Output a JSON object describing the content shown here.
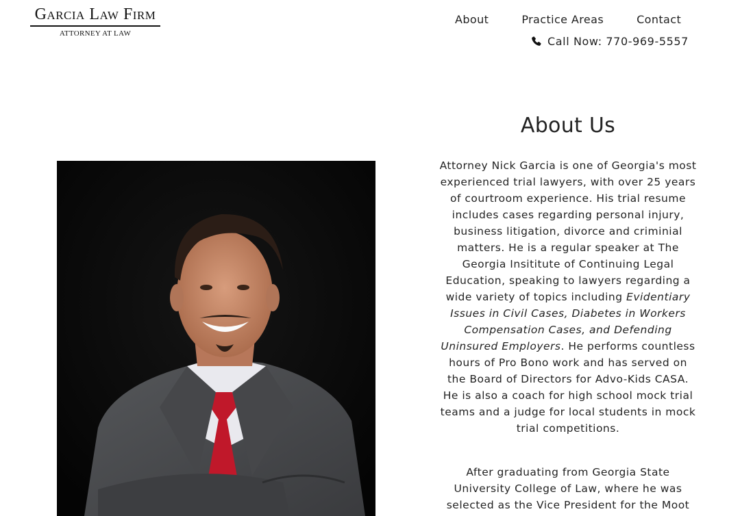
{
  "header": {
    "logo_title": "Garcia Law Firm",
    "logo_subtitle": "ATTORNEY AT LAW",
    "nav": [
      "About",
      "Practice Areas",
      "Contact"
    ],
    "call_label": "Call Now: 770-969-5557",
    "phone_icon": "phone-icon"
  },
  "about": {
    "title": "About Us",
    "p1_a": "Attorney Nick Garcia is one of Georgia's most experienced trial lawyers, with over 25 years of courtroom experience. His trial resume includes cases regarding personal injury, business litigation, divorce and criminial matters. He is a regular speaker at The Georgia Insititute of Continuing Legal Education, speaking to lawyers regarding a wide variety of topics including ",
    "p1_em": "Evidentiary Issues in Civil Cases, Diabetes in Workers Compensation Cases, and Defending Uninsured Employers",
    "p1_b": ". He performs countless hours of Pro Bono work and has served on the Board of Directors for Advo-Kids CASA. He is also a coach for high school mock trial teams and a judge for local students in mock trial competitions.",
    "p2": "After graduating from Georgia State University College of Law, where he was selected as the Vice President for the Moot"
  },
  "colors": {
    "text": "#222222",
    "photo_bg": "#070707",
    "tie": "#c0182a",
    "suit": "#4a4b4d"
  }
}
